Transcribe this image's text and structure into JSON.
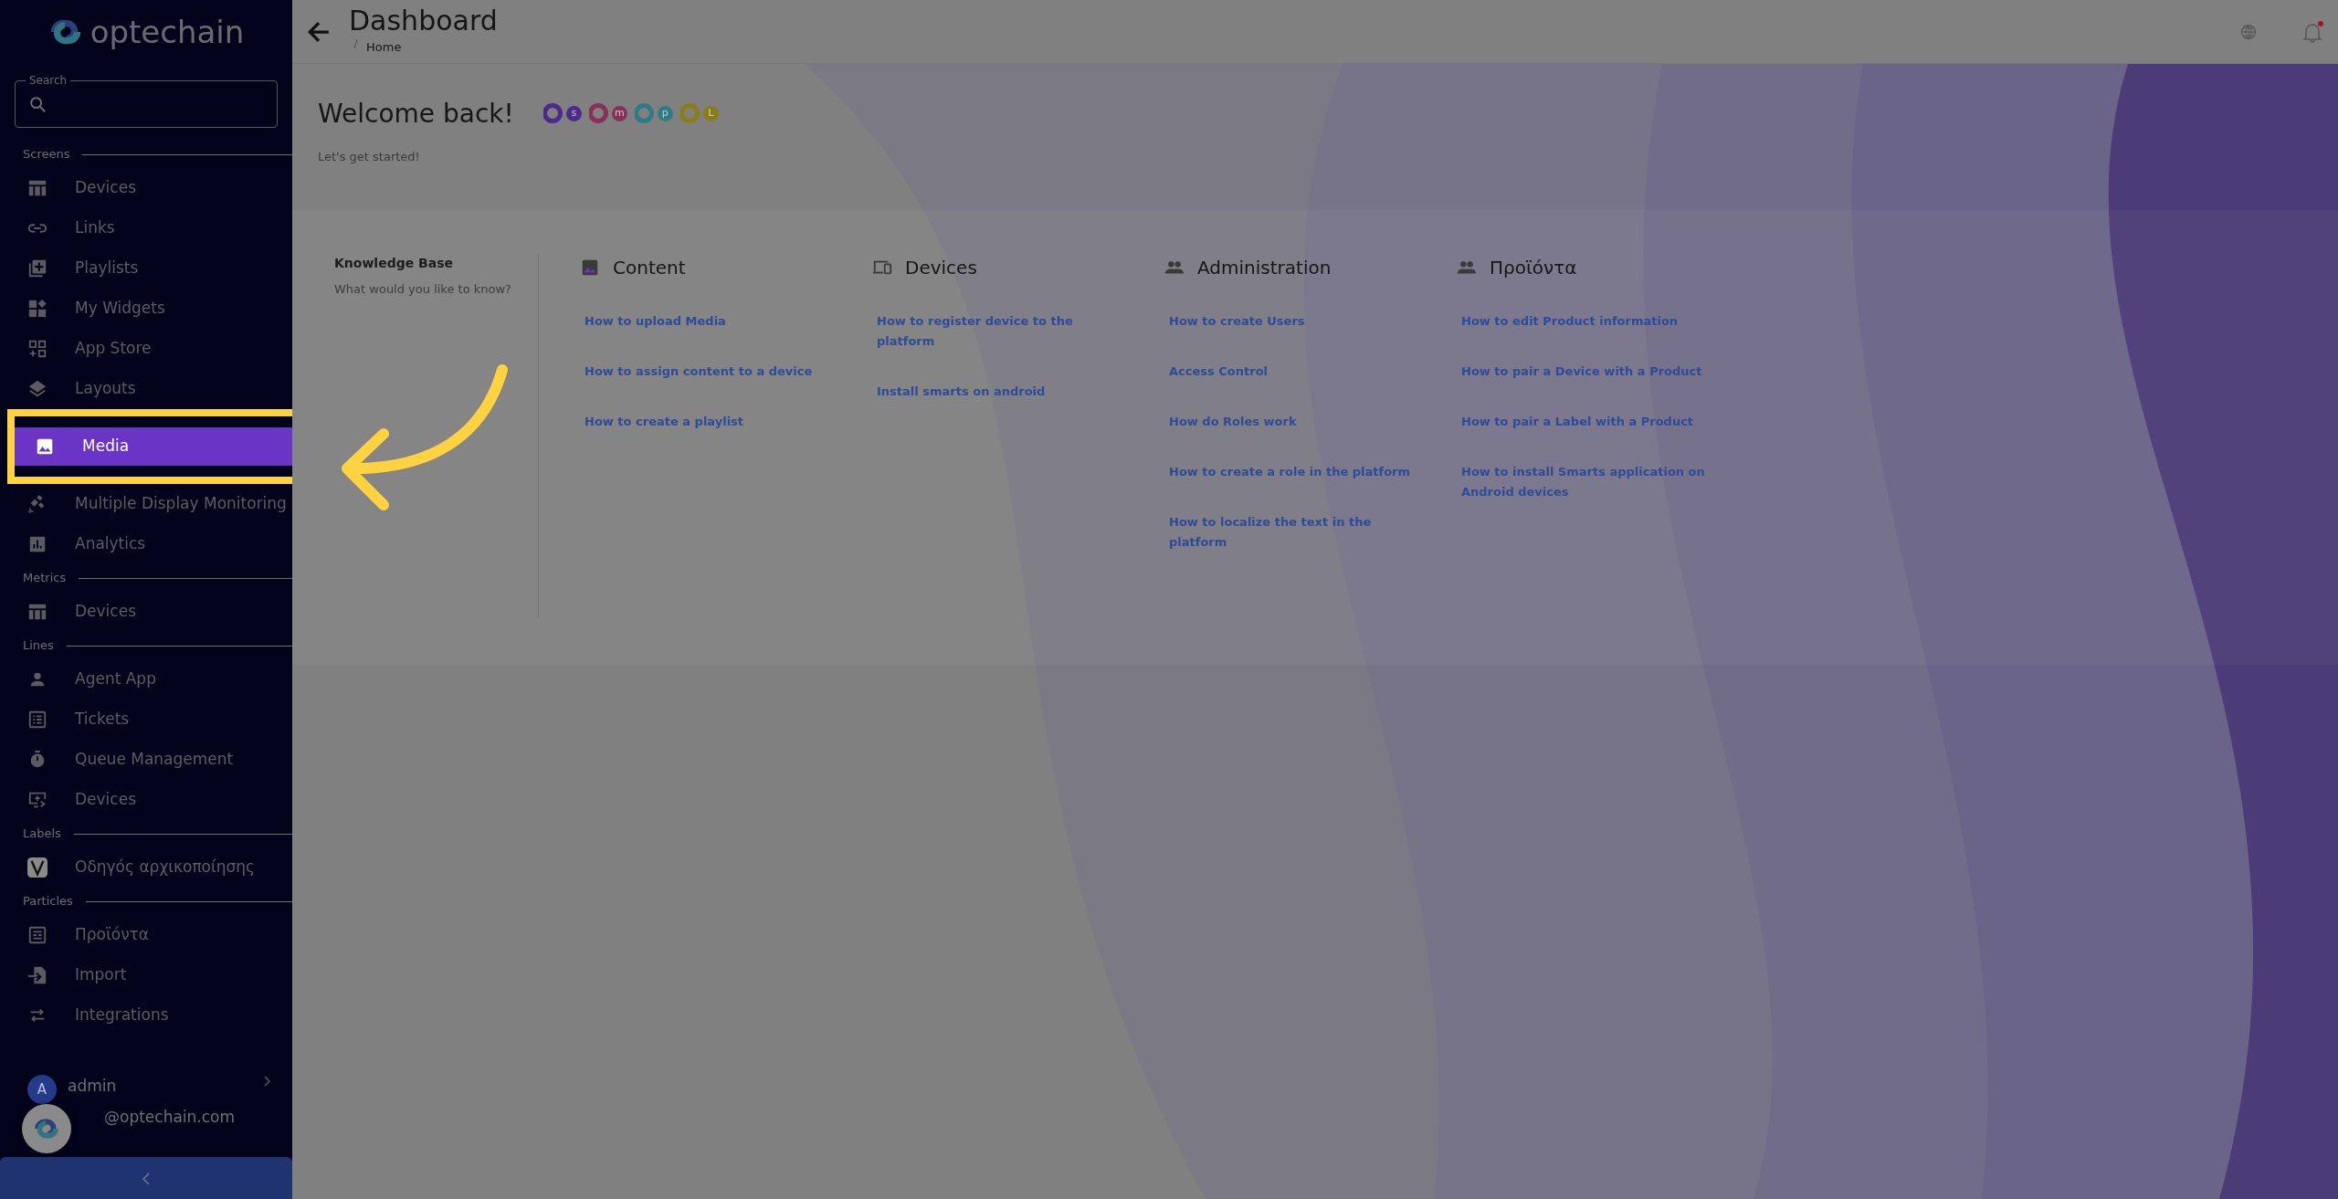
{
  "brand": {
    "name": "optechain"
  },
  "search": {
    "label": "Search"
  },
  "sidebar": {
    "sections": [
      {
        "title": "Screens",
        "items": [
          {
            "label": "Devices",
            "kind": "table",
            "selected": false
          },
          {
            "label": "Links",
            "kind": "link",
            "selected": false
          },
          {
            "label": "Playlists",
            "kind": "playlist",
            "selected": false
          },
          {
            "label": "My Widgets",
            "kind": "widgets",
            "selected": false
          },
          {
            "label": "App Store",
            "kind": "apps",
            "selected": false
          },
          {
            "label": "Layouts",
            "kind": "layers",
            "selected": false
          },
          {
            "label": "Media",
            "kind": "image",
            "selected": true
          },
          {
            "label": "Multiple Display Monitoring",
            "kind": "satellite",
            "selected": false
          },
          {
            "label": "Analytics",
            "kind": "chart",
            "selected": false
          }
        ]
      },
      {
        "title": "Metrics",
        "items": [
          {
            "label": "Devices",
            "kind": "table",
            "selected": false
          }
        ]
      },
      {
        "title": "Lines",
        "items": [
          {
            "label": "Agent App",
            "kind": "person",
            "selected": false
          },
          {
            "label": "Tickets",
            "kind": "list",
            "selected": false
          },
          {
            "label": "Queue Management",
            "kind": "timer",
            "selected": false
          },
          {
            "label": "Devices",
            "kind": "monitor",
            "selected": false
          }
        ]
      },
      {
        "title": "Labels",
        "items": [
          {
            "label": "Οδηγός αρχικοποίησης",
            "kind": "vlogo",
            "selected": false
          }
        ]
      },
      {
        "title": "Particles",
        "items": [
          {
            "label": "Προϊόντα",
            "kind": "article",
            "selected": false
          },
          {
            "label": "Import",
            "kind": "import",
            "selected": false
          },
          {
            "label": "Integrations",
            "kind": "swap",
            "selected": false
          }
        ]
      }
    ]
  },
  "user": {
    "avatar": "A",
    "name": "admin",
    "email": "@optechain.com"
  },
  "header": {
    "title": "Dashboard",
    "breadcrumb": [
      "Home"
    ]
  },
  "welcome": {
    "title": "Welcome back!",
    "subtitle": "Let's get started!",
    "apps": [
      {
        "letter": "s",
        "color": "#4a2a8a"
      },
      {
        "letter": "m",
        "color": "#8a2f55"
      },
      {
        "letter": "p",
        "color": "#2f7c86"
      },
      {
        "letter": "L",
        "color": "#8a7f14"
      }
    ]
  },
  "knowledge_base": {
    "title": "Knowledge Base",
    "subtitle": "What would you like to know?",
    "columns": [
      {
        "title": "Content",
        "kind": "image",
        "links": [
          "How to upload Media",
          "How to assign content to a device",
          "How to create a playlist"
        ]
      },
      {
        "title": "Devices",
        "kind": "devices",
        "links": [
          "How to register device to the platform",
          "Install smarts on android"
        ]
      },
      {
        "title": "Administration",
        "kind": "people",
        "links": [
          "How to create Users",
          "Access Control",
          "How do Roles work",
          "How to create a role in the platform",
          "How to localize the text in the platform"
        ]
      },
      {
        "title": "Προϊόντα",
        "kind": "people",
        "links": [
          "How to edit Product information",
          "How to pair a Device with a Product",
          "How to pair a Label with a Product",
          "How to install Smarts application on Android devices"
        ]
      }
    ]
  },
  "notifications": {
    "unread": true
  }
}
